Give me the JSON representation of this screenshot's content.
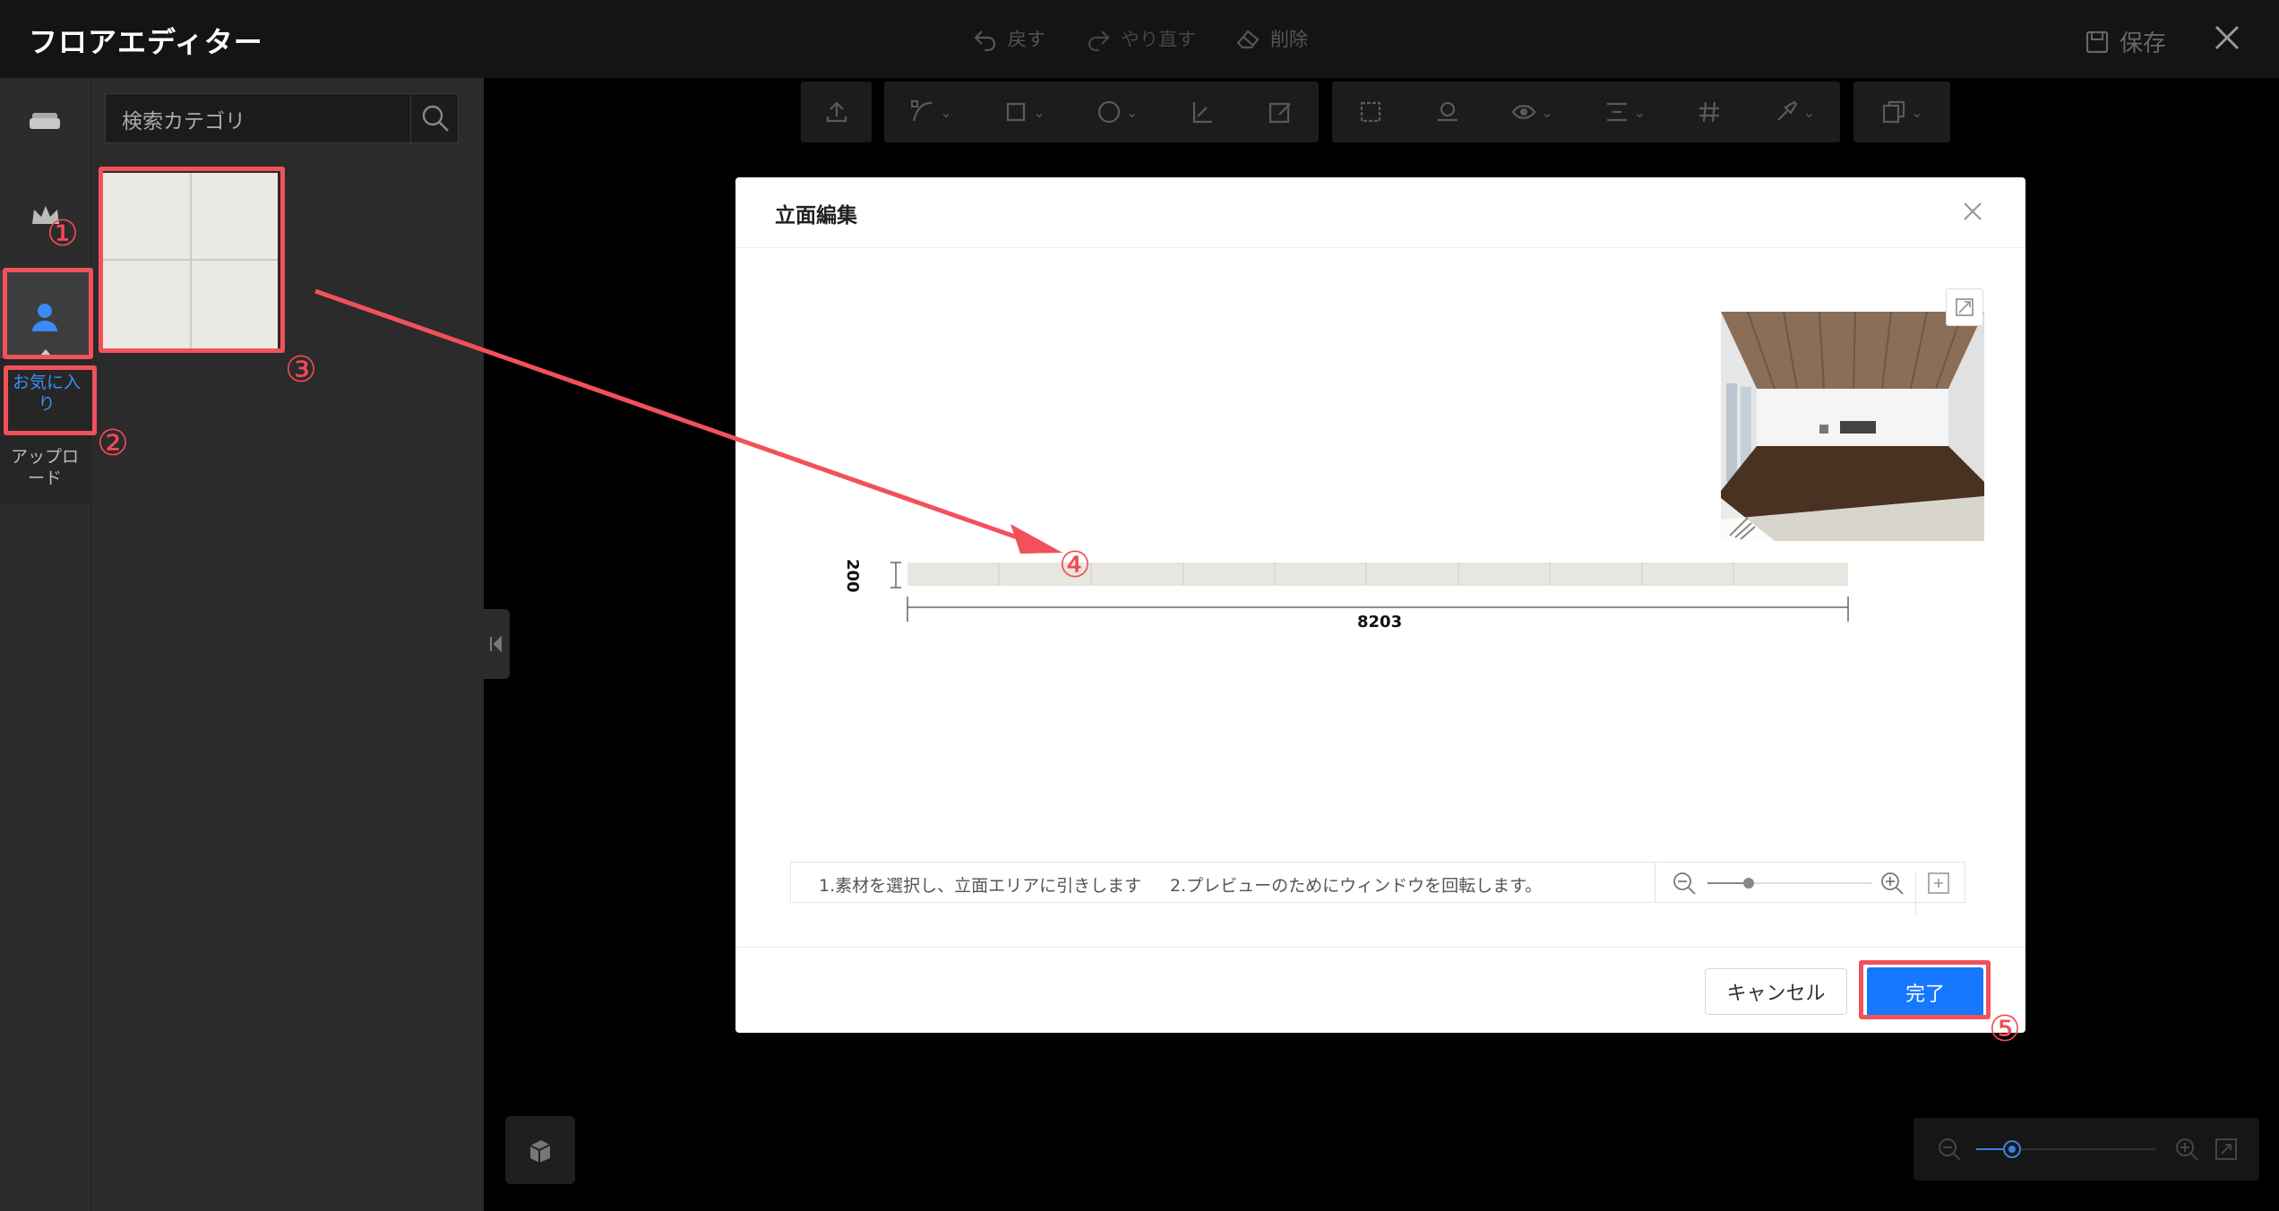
{
  "app": {
    "title": "フロアエディター",
    "undo": "戻す",
    "redo": "やり直す",
    "delete": "削除",
    "save": "保存"
  },
  "sidebar": {
    "favorites_label": "お気に入り",
    "upload_label": "アップロード"
  },
  "library": {
    "search_placeholder": "検索カテゴリ"
  },
  "dialog": {
    "title": "立面編集",
    "height_dim": "200",
    "width_dim": "8203",
    "instruction_1": "1.素材を選択し、立面エリアに引きします",
    "instruction_2": "2.プレビューのためにウィンドウを回転します。",
    "zoom_level": 0.25,
    "cancel_label": "キャンセル",
    "done_label": "完了"
  },
  "annotations": {
    "step1": "①",
    "step2": "②",
    "step3": "③",
    "step4": "④",
    "step5": "⑤"
  },
  "canvas": {
    "zoom_level": 0.2
  },
  "colors": {
    "accent": "#1677ff",
    "annotation": "#f2515b",
    "favorites_text": "#3a8ef6"
  }
}
